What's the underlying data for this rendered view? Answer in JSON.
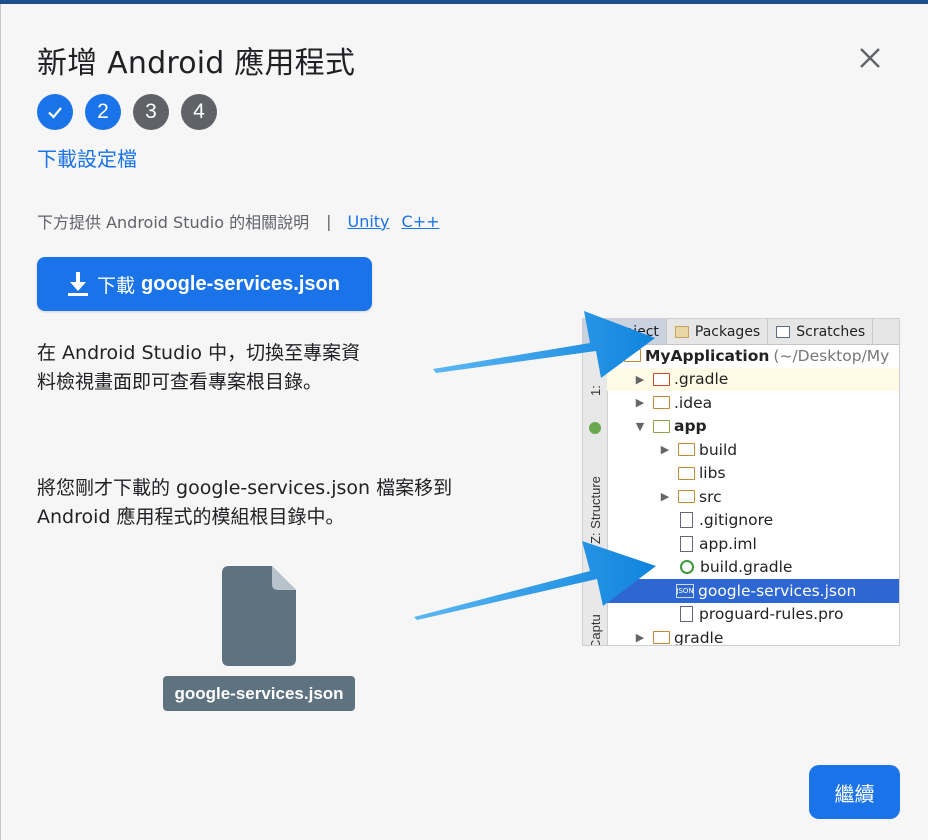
{
  "dialog": {
    "title": "新增 Android 應用程式",
    "close_icon": "close-icon"
  },
  "steps": [
    {
      "label": "✓",
      "state": "done"
    },
    {
      "label": "2",
      "state": "active"
    },
    {
      "label": "3",
      "state": "pending"
    },
    {
      "label": "4",
      "state": "pending"
    }
  ],
  "step_label": "下載設定檔",
  "docs": {
    "text": "下方提供 Android Studio 的相關說明",
    "separator": "|",
    "links": [
      "Unity",
      "C++"
    ]
  },
  "download_button": {
    "prefix": "下載",
    "filename": "google-services.json",
    "icon": "download-icon"
  },
  "instructions": {
    "line1a": "在 Android Studio 中，切換至專案資",
    "line1b": "料檢視畫面即可查看專案根目錄。",
    "line2a": "將您剛才下載的 google-services.json 檔案移到",
    "line2b": "Android 應用程式的模組根目錄中。"
  },
  "file_chip": "google-services.json",
  "continue_label": "繼續",
  "ide": {
    "tabs": [
      "Project",
      "Packages",
      "Scratches"
    ],
    "gutter": [
      "1:",
      "Z: Structure",
      "Captu"
    ],
    "tree": [
      {
        "arrow": "▼",
        "label": "MyApplication",
        "path": "(~/Desktop/My",
        "bold": true,
        "indent": 0,
        "icon": "folder"
      },
      {
        "arrow": "▶",
        "label": ".gradle",
        "indent": 1,
        "icon": "folder-red",
        "highlight": true
      },
      {
        "arrow": "▶",
        "label": ".idea",
        "indent": 1,
        "icon": "folder"
      },
      {
        "arrow": "▼",
        "label": "app",
        "bold": true,
        "indent": 1,
        "icon": "folder-green"
      },
      {
        "arrow": "▶",
        "label": "build",
        "indent": 2,
        "icon": "folder"
      },
      {
        "arrow": "",
        "label": "libs",
        "indent": 2,
        "icon": "folder"
      },
      {
        "arrow": "▶",
        "label": "src",
        "indent": 2,
        "icon": "folder"
      },
      {
        "arrow": "",
        "label": ".gitignore",
        "indent": 2,
        "icon": "file"
      },
      {
        "arrow": "",
        "label": "app.iml",
        "indent": 2,
        "icon": "file"
      },
      {
        "arrow": "",
        "label": "build.gradle",
        "indent": 2,
        "icon": "gradle"
      },
      {
        "arrow": "",
        "label": "google-services.json",
        "indent": 2,
        "icon": "json",
        "selected": true
      },
      {
        "arrow": "",
        "label": "proguard-rules.pro",
        "indent": 2,
        "icon": "file"
      },
      {
        "arrow": "▶",
        "label": "gradle",
        "indent": 1,
        "icon": "folder"
      }
    ]
  },
  "colors": {
    "primary": "#1a73e8",
    "pending_step": "#5f6368",
    "arrow": "#1e8ee6",
    "selected_row": "#2e67d3"
  }
}
